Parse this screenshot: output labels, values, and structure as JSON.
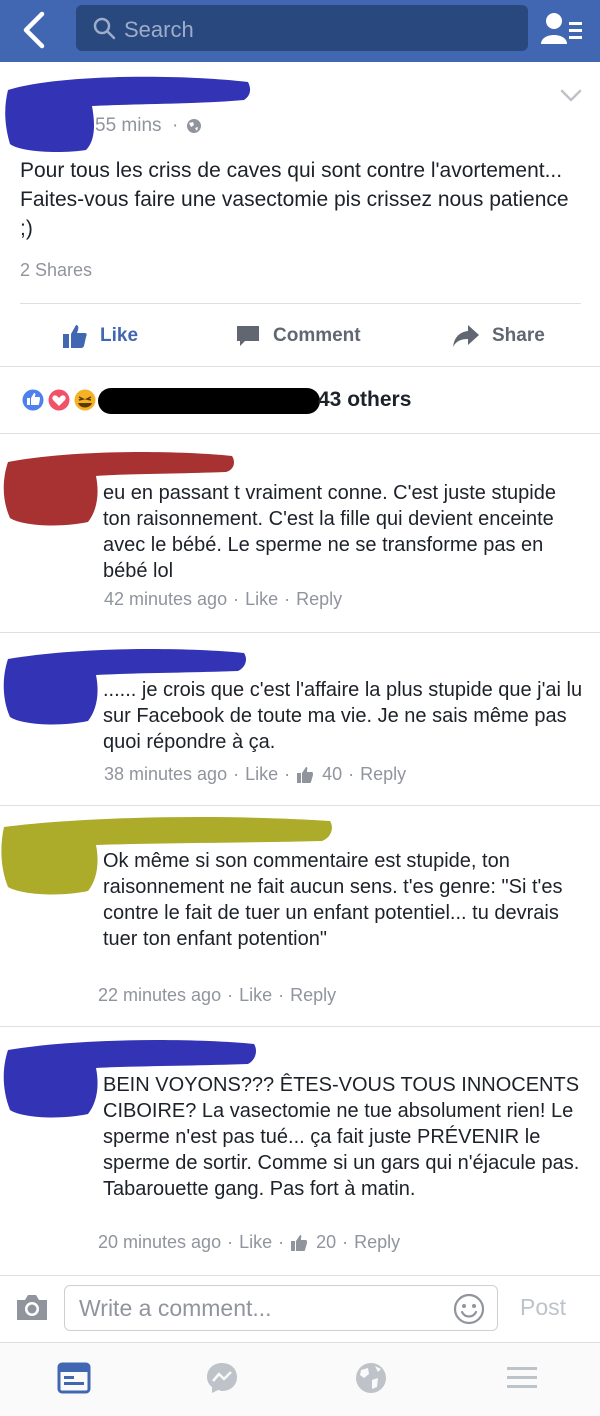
{
  "colors": {
    "brand": "#4267b2",
    "brand_dark": "#29487d",
    "secondary_text": "#90949c",
    "redaction_blue": "#3333b5",
    "redaction_red": "#a83232",
    "redaction_olive": "#adab2a"
  },
  "nav": {
    "back_icon": "chevron-left-icon",
    "search_placeholder": "Search",
    "friends_icon": "friend-requests-icon"
  },
  "post": {
    "time": "55 mins",
    "privacy_icon": "globe-icon",
    "text": "Pour tous les criss de caves qui sont contre l'avortement... Faites-vous faire une vasectomie pis crissez nous patience ;)",
    "shares": "2 Shares",
    "actions": {
      "like": "Like",
      "comment": "Comment",
      "share": "Share"
    },
    "reactions_summary": "43 others"
  },
  "comments": [
    {
      "text": "eu en passant t vraiment conne. C'est juste stupide ton raisonnement. C'est la fille qui devient enceinte avec le bébé. Le sperme ne se transforme pas en bébé lol",
      "time": "42 minutes ago",
      "like": "Like",
      "reply": "Reply",
      "likes": ""
    },
    {
      "text": "......  je crois que c'est l'affaire la plus stupide que j'ai lu sur Facebook de toute ma vie. Je ne sais même pas quoi répondre à ça.",
      "time": "38 minutes ago",
      "like": "Like",
      "reply": "Reply",
      "likes": "40"
    },
    {
      "text": "Ok même si son commentaire est stupide, ton raisonnement ne fait aucun sens. t'es genre: \"Si t'es contre le fait de tuer un enfant potentiel... tu devrais tuer ton enfant potention\"",
      "time": "22 minutes ago",
      "like": "Like",
      "reply": "Reply",
      "likes": ""
    },
    {
      "text": "BEIN VOYONS??? ÊTES-VOUS TOUS INNOCENTS CIBOIRE? La vasectomie ne tue absolument rien! Le sperme n'est pas tué... ça fait juste PRÉVENIR le sperme de sortir. Comme si un gars qui n'éjacule pas. Tabarouette gang. Pas fort à matin.",
      "time": "20 minutes ago",
      "like": "Like",
      "reply": "Reply",
      "likes": "20"
    }
  ],
  "composer": {
    "placeholder": "Write a comment...",
    "post_label": "Post"
  },
  "tabs": [
    "news-feed-icon",
    "messenger-icon",
    "globe-notifications-icon",
    "menu-icon"
  ]
}
